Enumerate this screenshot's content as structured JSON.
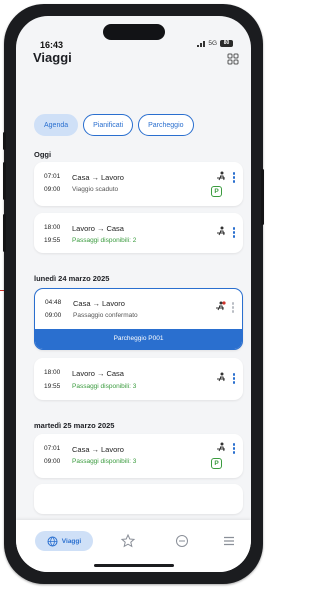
{
  "status_bar": {
    "time": "16:43",
    "network": "5G",
    "battery": "80"
  },
  "header": {
    "title": "Viaggi",
    "grid_icon": "grid-icon"
  },
  "tabs": [
    {
      "label": "Agenda",
      "active": true
    },
    {
      "label": "Pianificati",
      "active": false
    },
    {
      "label": "Parcheggio",
      "active": false
    }
  ],
  "sections": [
    {
      "label": "Oggi"
    },
    {
      "label": "lunedì 24 marzo 2025"
    },
    {
      "label": "martedì 25 marzo 2025"
    }
  ],
  "trips": [
    {
      "depart": "07:01",
      "arrive": "09:00",
      "from": "Casa",
      "to": "Lavoro",
      "status": "Viaggio scaduto",
      "status_color": "gray",
      "parking": true
    },
    {
      "depart": "18:00",
      "arrive": "19:55",
      "from": "Lavoro",
      "to": "Casa",
      "status": "Passaggi disponibili: 2",
      "status_color": "green",
      "parking": false
    },
    {
      "depart": "04:48",
      "arrive": "09:00",
      "from": "Casa",
      "to": "Lavoro",
      "status": "Passaggio confermato",
      "status_color": "gray",
      "parking": false,
      "footer": "Parcheggio P001"
    },
    {
      "depart": "18:00",
      "arrive": "19:55",
      "from": "Lavoro",
      "to": "Casa",
      "status": "Passaggi disponibili: 3",
      "status_color": "green",
      "parking": false
    },
    {
      "depart": "07:01",
      "arrive": "09:00",
      "from": "Casa",
      "to": "Lavoro",
      "status": "Passaggi disponibili: 3",
      "status_color": "green",
      "parking": true
    }
  ],
  "arrow": "→",
  "parking_badge": "P",
  "bottom_nav": {
    "active_label": "Viaggi"
  },
  "colors": {
    "accent": "#2a6fcf",
    "green": "#3a9b3e",
    "pill": "#cfe0f7"
  }
}
